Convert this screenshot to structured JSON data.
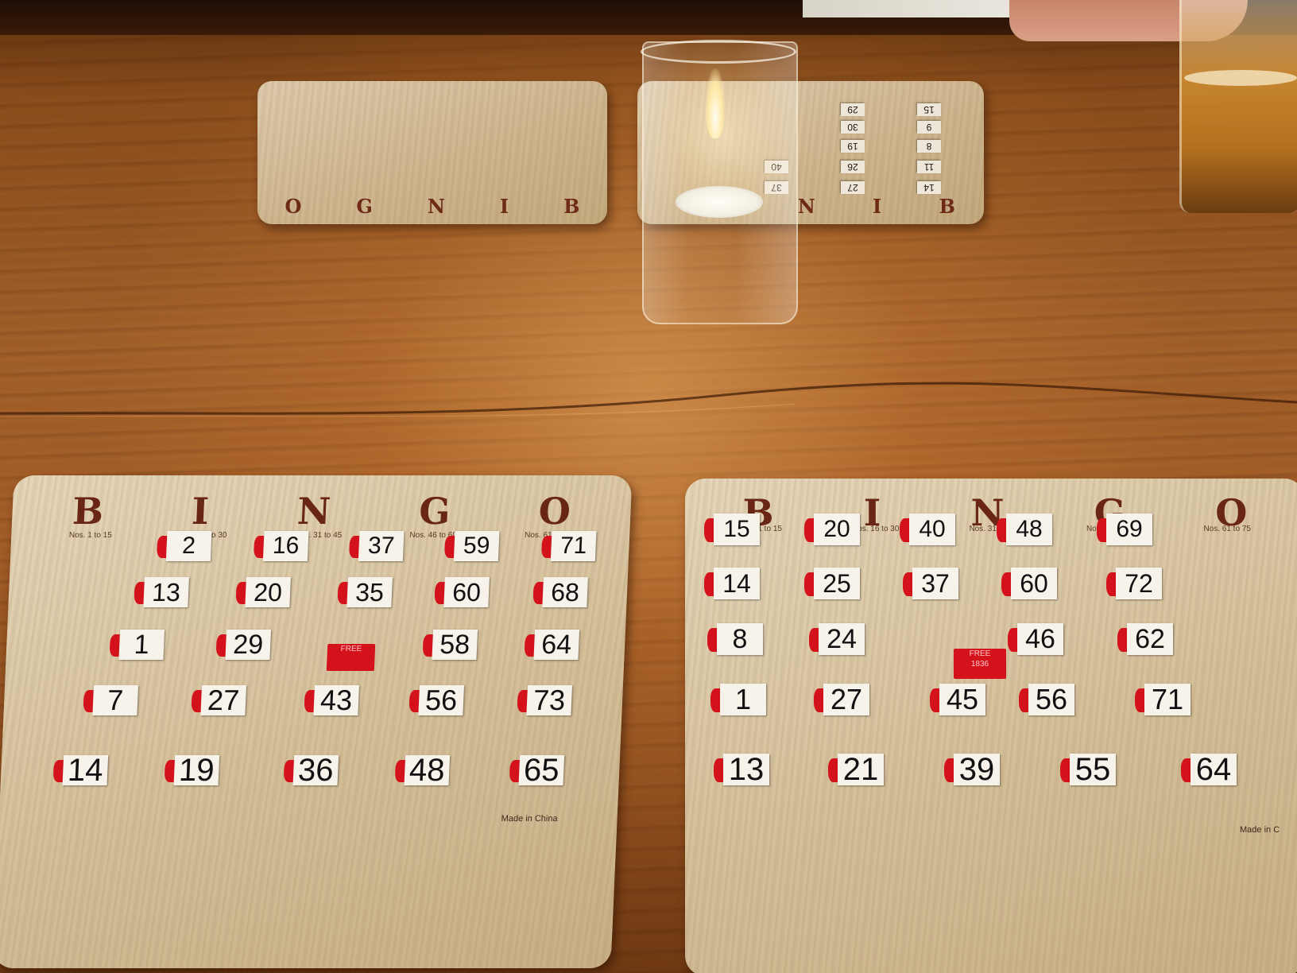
{
  "scene": "bingo-table",
  "colors": {
    "table_wood": "#a2602a",
    "card_wood": "#d6c19b",
    "slider_red": "#d4121c",
    "letter_brown": "#6a2615"
  },
  "front_left_card": {
    "letters": [
      "B",
      "I",
      "N",
      "G",
      "O"
    ],
    "ranges": [
      "Nos. 1 to 15",
      "Nos. 16 to 30",
      "Nos. 31 to 45",
      "Nos. 46 to 60",
      "Nos. 61 to 75"
    ],
    "columns": [
      [
        "2",
        "13",
        "1",
        "7",
        "14"
      ],
      [
        "16",
        "20",
        "29",
        "27",
        "19"
      ],
      [
        "37",
        "35",
        "",
        "43",
        "36"
      ],
      [
        "59",
        "60",
        "58",
        "56",
        "48"
      ],
      [
        "71",
        "68",
        "64",
        "73",
        "65"
      ]
    ],
    "free_label": "FREE",
    "footer": "Made in China"
  },
  "front_right_card": {
    "letters": [
      "B",
      "I",
      "N",
      "G",
      "O"
    ],
    "ranges": [
      "Nos. 1 to 15",
      "Nos. 16 to 30",
      "Nos. 31 to 45",
      "Nos. 46 to 60",
      "Nos. 61 to 75"
    ],
    "columns": [
      [
        "15",
        "14",
        "8",
        "1",
        "13"
      ],
      [
        "20",
        "25",
        "24",
        "27",
        "21"
      ],
      [
        "40",
        "37",
        "",
        "45",
        "39"
      ],
      [
        "48",
        "60",
        "46",
        "56",
        "55"
      ],
      [
        "69",
        "72",
        "62",
        "71",
        "64"
      ]
    ],
    "free_label": "FREE",
    "free_code": "1836",
    "footer": "Made in C"
  },
  "back_left_card": {
    "letters": [
      "O",
      "G",
      "N",
      "I",
      "B"
    ]
  },
  "back_right_card": {
    "letters": [
      "N",
      "I",
      "B"
    ],
    "columns": [
      [
        "14",
        "11",
        "8",
        "9",
        "15"
      ],
      [
        "27",
        "26",
        "19",
        "30",
        "29"
      ],
      [
        "37",
        "40",
        "",
        "",
        ""
      ]
    ]
  }
}
